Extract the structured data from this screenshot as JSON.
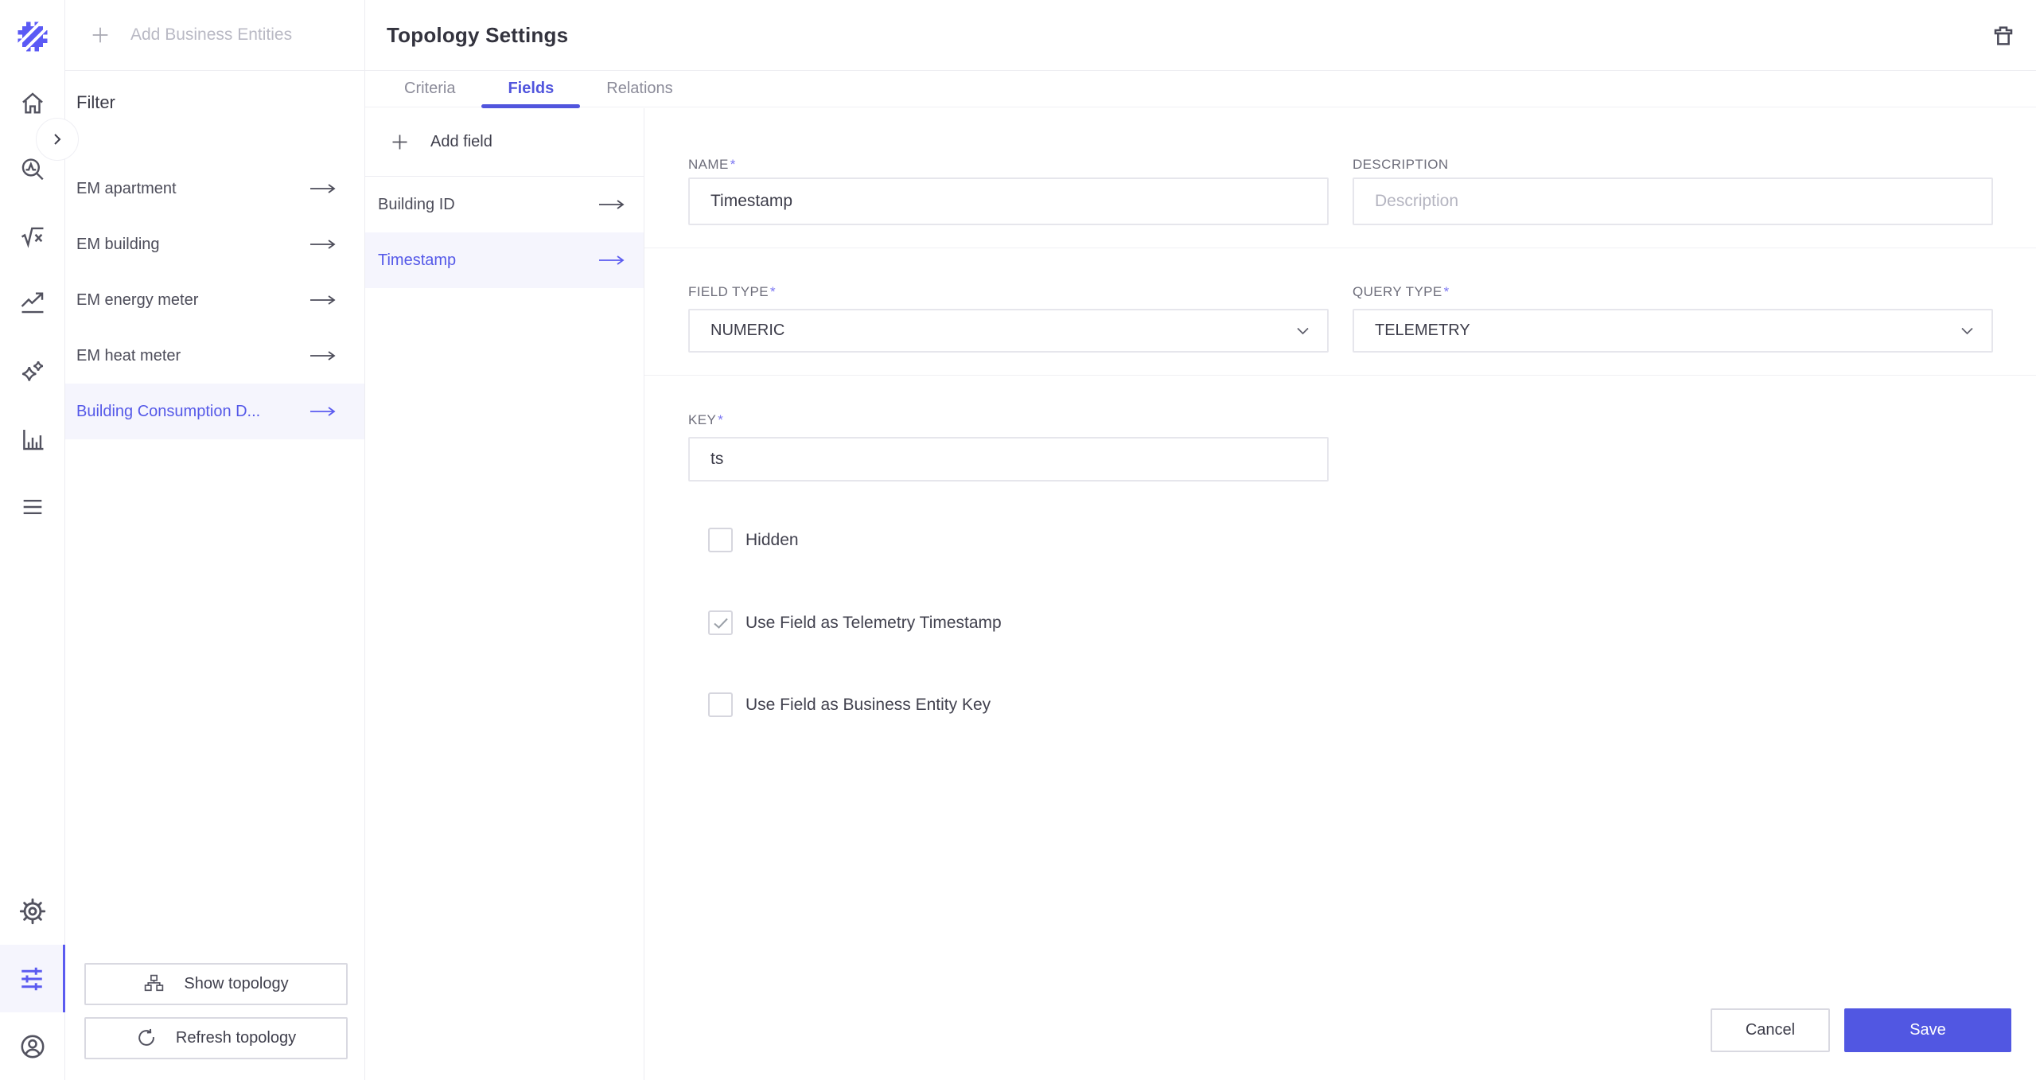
{
  "theme": {
    "accent": "#5559e8",
    "accent_strong": "#5157e2",
    "logo_color": "#5b5af5",
    "highlight_bg": "#f5f5fd",
    "panel_border": "#ececf1",
    "icon_gray": "#52525f"
  },
  "icons": [
    "logo",
    "home-icon",
    "chevron-right-icon",
    "search-analytics-icon",
    "formula-icon",
    "trend-icon",
    "sparkles-icon",
    "bar-chart-icon",
    "menu-icon",
    "gear-icon",
    "filter-sliders-icon",
    "account-icon",
    "plus-icon",
    "arrow-right-icon",
    "trash-icon",
    "sitemap-icon",
    "refresh-icon",
    "chevron-down-icon",
    "check-icon"
  ],
  "topbar": {
    "add_business_entities_label": "Add Business Entities"
  },
  "sidebar": {
    "title": "Filter",
    "items": [
      {
        "label": "EM apartment",
        "active": false
      },
      {
        "label": "EM building",
        "active": false
      },
      {
        "label": "EM energy meter",
        "active": false
      },
      {
        "label": "EM heat meter",
        "active": false
      },
      {
        "label": "Building Consumption D...",
        "active": true
      }
    ],
    "actions": [
      {
        "label": "Show topology",
        "icon": "sitemap-icon"
      },
      {
        "label": "Refresh topology",
        "icon": "refresh-icon"
      }
    ]
  },
  "main": {
    "title": "Topology Settings",
    "tabs": [
      {
        "label": "Criteria",
        "active": false
      },
      {
        "label": "Fields",
        "active": true
      },
      {
        "label": "Relations",
        "active": false
      }
    ],
    "fields_panel": {
      "add_field_label": "Add field",
      "fields": [
        {
          "label": "Building ID",
          "active": false
        },
        {
          "label": "Timestamp",
          "active": true
        }
      ]
    },
    "form": {
      "required_mark": "*",
      "name": {
        "label": "NAME",
        "required": true,
        "value": "Timestamp"
      },
      "description": {
        "label": "DESCRIPTION",
        "required": false,
        "placeholder": "Description"
      },
      "field_type": {
        "label": "FIELD TYPE",
        "required": true,
        "value": "NUMERIC"
      },
      "query_type": {
        "label": "QUERY TYPE",
        "required": true,
        "value": "TELEMETRY"
      },
      "key": {
        "label": "KEY",
        "required": true,
        "value": "ts"
      },
      "checkboxes": [
        {
          "label": "Hidden",
          "checked": false
        },
        {
          "label": "Use Field as Telemetry Timestamp",
          "checked": true
        },
        {
          "label": "Use Field as Business Entity Key",
          "checked": false
        }
      ],
      "actions": {
        "cancel_label": "Cancel",
        "save_label": "Save"
      }
    }
  }
}
